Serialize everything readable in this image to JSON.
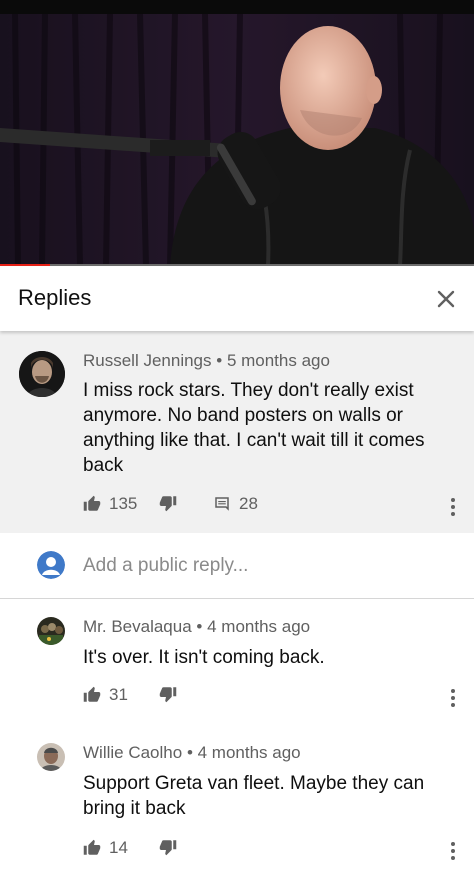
{
  "video": {
    "progress_fraction": 0.105
  },
  "header": {
    "title": "Replies",
    "close_icon": "close-icon"
  },
  "parent_comment": {
    "author": "Russell Jennings",
    "time": "5 months ago",
    "text": "I miss rock stars. They don't really exist anymore. No band posters on walls or anything like that. I can't wait till it comes back",
    "likes": "135",
    "replies": "28"
  },
  "add_reply": {
    "placeholder": "Add a public reply..."
  },
  "replies": [
    {
      "author": "Mr. Bevalaqua",
      "time": "4 months ago",
      "text": "It's over. It isn't coming back.",
      "likes": "31"
    },
    {
      "author": "Willie Caolho",
      "time": "4 months ago",
      "text": "Support Greta van fleet. Maybe they can bring it back",
      "likes": "14"
    }
  ],
  "colors": {
    "progress": "#e62117",
    "account_avatar": "#3f79c8"
  }
}
